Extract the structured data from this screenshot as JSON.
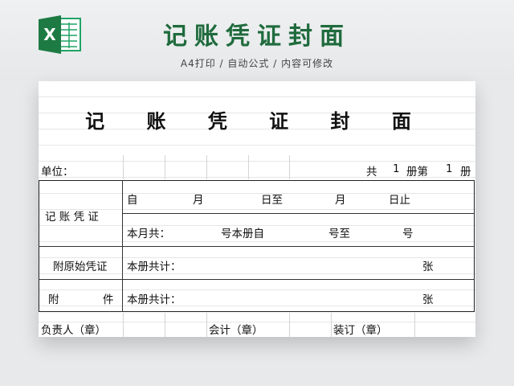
{
  "banner": {
    "title": "记账凭证封面",
    "subtitle": "A4打印 / 自动公式 / 内容可修改",
    "logo_icon": "excel-icon",
    "logo_letter": "X",
    "brand_color": "#1f6b3d"
  },
  "sheet": {
    "title": "记 账 凭 证 封 面",
    "unit_label": "单位：",
    "volume": {
      "prefix": "共",
      "total": "1",
      "mid": "册第",
      "current": "1",
      "suffix": "册"
    },
    "rows": {
      "voucher": {
        "label": "记 账 凭 证",
        "from": "自",
        "month1": "月",
        "day_to": "日至",
        "month2": "月",
        "day_end": "日止",
        "month_total": "本月共：",
        "book_from": "号本册自",
        "num_to": "号至",
        "num_end": "号"
      },
      "original": {
        "label": "附原始凭证",
        "count_label": "本册共计：",
        "unit": "张"
      },
      "attachment": {
        "label_a": "附",
        "label_b": "件",
        "count_label": "本册共计：",
        "unit": "张"
      }
    },
    "signatures": {
      "responsible": "负责人（章）",
      "accountant": "会计（章）",
      "binder": "装订（章）"
    }
  }
}
